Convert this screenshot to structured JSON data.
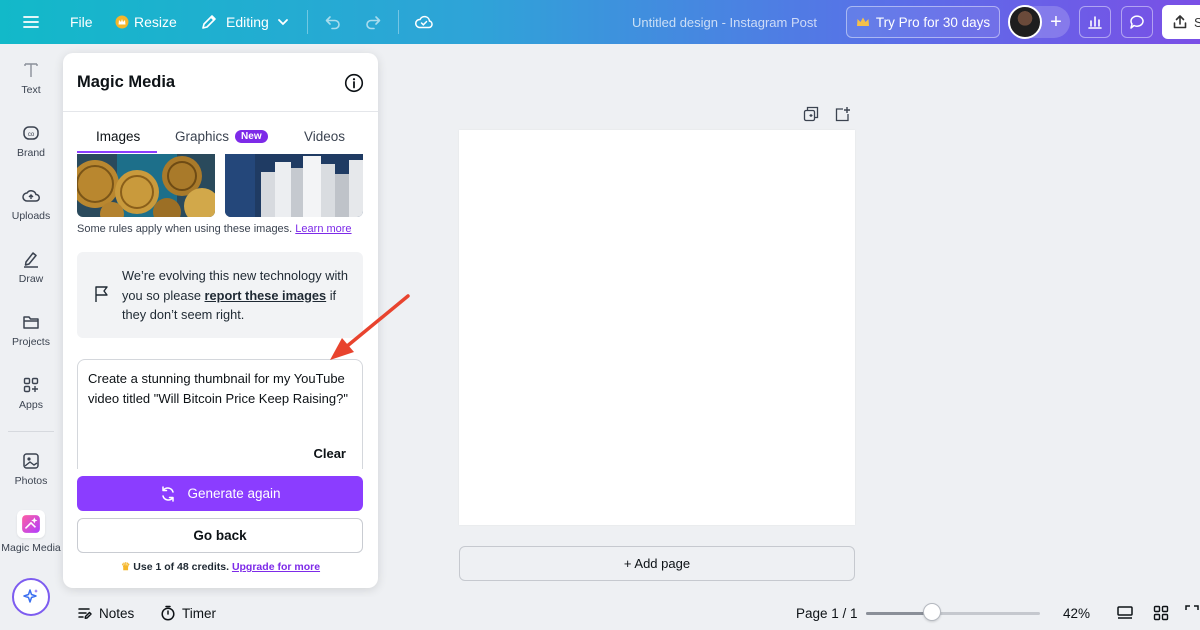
{
  "topbar": {
    "file_label": "File",
    "resize_label": "Resize",
    "editing_label": "Editing",
    "design_title": "Untitled design - Instagram Post",
    "try_pro_label": "Try Pro for 30 days",
    "share_label": "S"
  },
  "rail": {
    "items": [
      {
        "label": "Text",
        "icon": "text-icon"
      },
      {
        "label": "Brand",
        "icon": "brand-icon"
      },
      {
        "label": "Uploads",
        "icon": "upload-cloud-icon"
      },
      {
        "label": "Draw",
        "icon": "draw-icon"
      },
      {
        "label": "Projects",
        "icon": "folder-icon"
      },
      {
        "label": "Apps",
        "icon": "apps-grid-icon"
      },
      {
        "label": "Photos",
        "icon": "image-icon"
      },
      {
        "label": "Magic Media",
        "icon": "magic-media-icon"
      }
    ]
  },
  "panel": {
    "title": "Magic Media",
    "tabs": [
      {
        "label": "Images",
        "active": true
      },
      {
        "label": "Graphics",
        "badge": "New"
      },
      {
        "label": "Videos"
      }
    ],
    "rules_text": "Some rules apply when using these images.",
    "rules_link": "Learn more",
    "notice": {
      "part1": "We’re evolving this new technology with you so please ",
      "link": "report these images",
      "part2": " if they don’t seem right."
    },
    "prompt": "Create a stunning thumbnail for my YouTube video titled \"Will Bitcoin Price Keep Raising?\"",
    "clear_label": "Clear",
    "generate_label": "Generate again",
    "back_label": "Go back",
    "credits_text": "Use 1 of 48 credits.",
    "credits_link": "Upgrade for more"
  },
  "canvas": {
    "add_page_label": "+ Add page"
  },
  "bottombar": {
    "notes_label": "Notes",
    "timer_label": "Timer",
    "page_label": "Page 1 / 1",
    "zoom_label": "42%",
    "zoom_level": 0.38
  },
  "colors": {
    "accent": "#8b3dff",
    "annotation_arrow": "#e8432e"
  }
}
